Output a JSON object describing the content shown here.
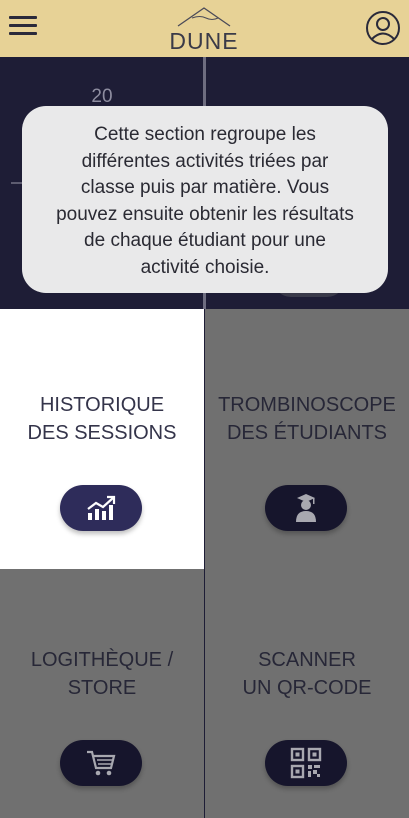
{
  "header": {
    "logo_text": "DUNE",
    "menu_icon": "hamburger-menu-icon",
    "profile_icon": "user-profile-icon"
  },
  "top_section": {
    "value": "20"
  },
  "tooltip": {
    "lines": [
      "Cette section regroupe les",
      "différentes activités triées par",
      "classe puis par matière. Vous",
      "pouvez ensuite obtenir les résultats",
      "de chaque étudiant pour une",
      "activité choisie."
    ]
  },
  "tiles": [
    {
      "line1": "HISTORIQUE",
      "line2": "DES SESSIONS",
      "icon": "chart-trend-icon"
    },
    {
      "line1": "TROMBINOSCOPE",
      "line2": "DES ÉTUDIANTS",
      "icon": "graduate-student-icon"
    },
    {
      "line1": "LOGITHÈQUE /",
      "line2": "STORE",
      "icon": "shopping-cart-icon"
    },
    {
      "line1": "SCANNER",
      "line2": "UN QR-CODE",
      "icon": "qr-code-icon"
    }
  ],
  "colors": {
    "header_bg": "#e7d296",
    "dark_navy": "#1e1d36",
    "button_navy": "#2e2c5a",
    "overlay_gray": "#707070",
    "tooltip_bg": "#e9e9ea"
  }
}
